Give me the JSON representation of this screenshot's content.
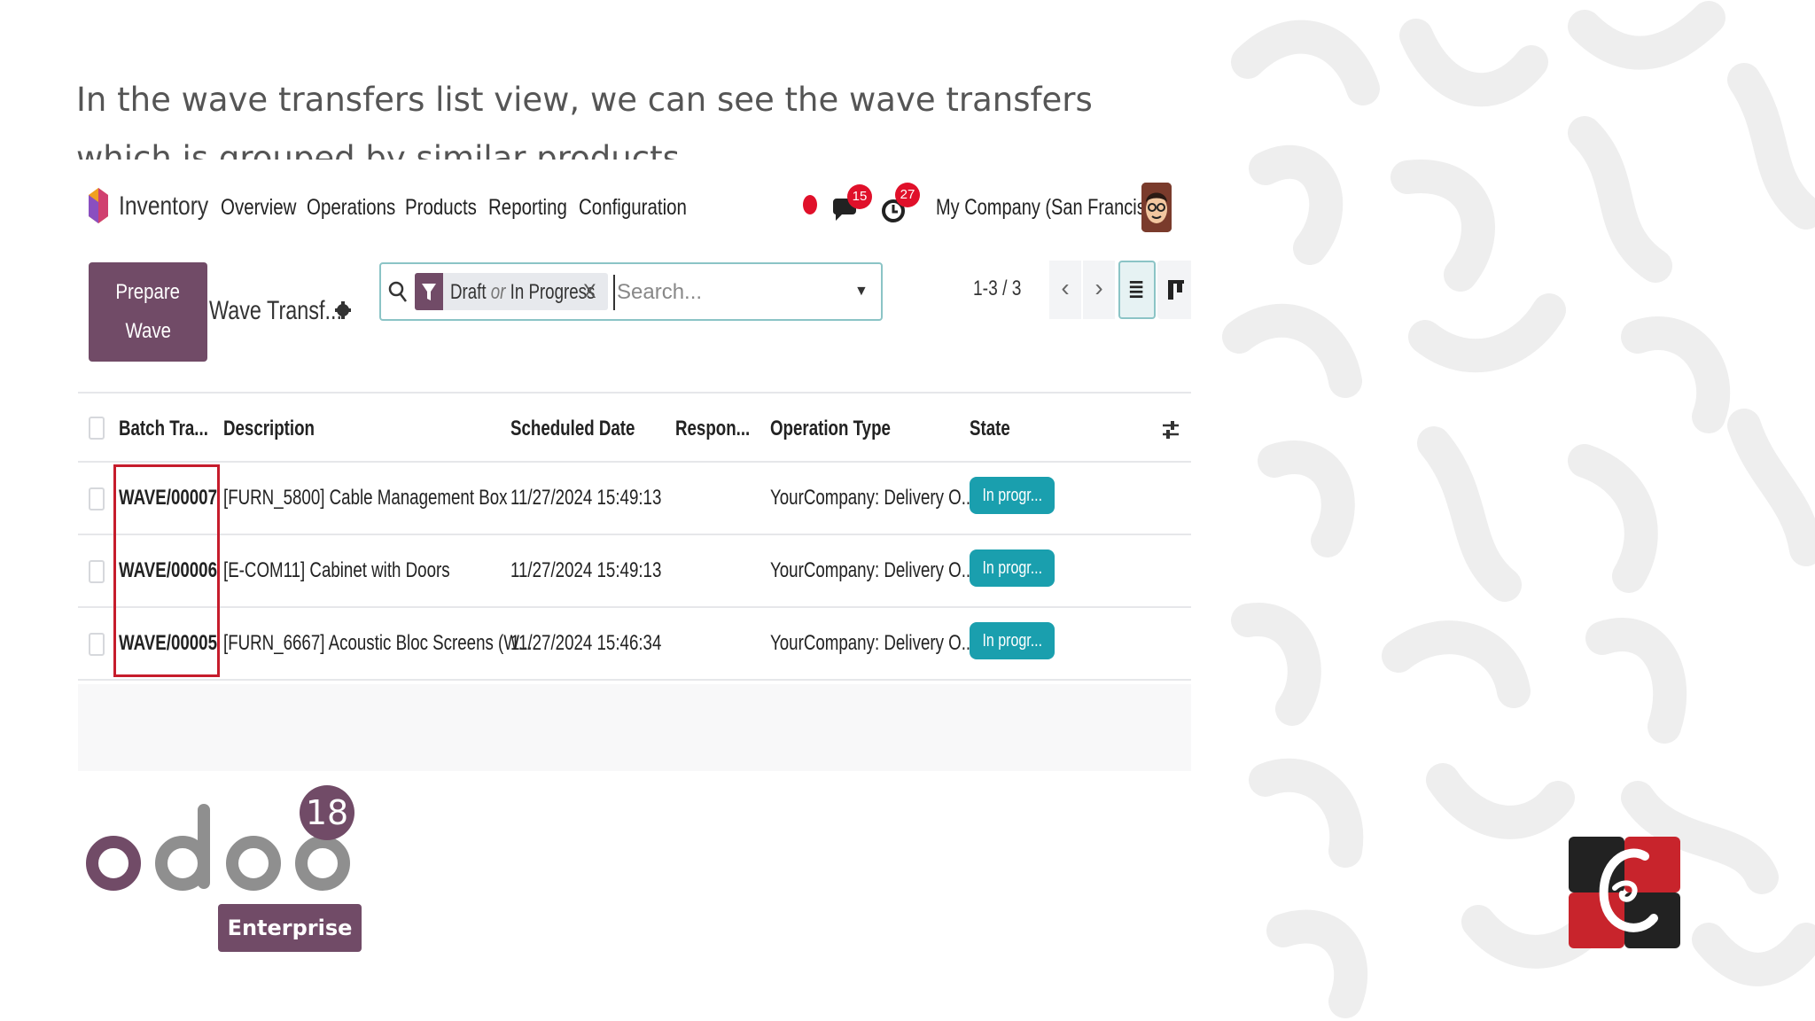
{
  "caption": "In the wave transfers list view, we can see the wave transfers which is grouped by similar products",
  "navbar": {
    "app_name": "Inventory",
    "menu": [
      "Overview",
      "Operations",
      "Products",
      "Reporting",
      "Configuration"
    ],
    "messages_count": "15",
    "activities_count": "27",
    "company": "My Company (San Francisco)"
  },
  "control_panel": {
    "prepare_line1": "Prepare",
    "prepare_line2": "Wave",
    "view_title": "Wave Transf...",
    "facet_part1": "Draft",
    "facet_or": "or",
    "facet_part2": "In Progress",
    "facet_close": "X",
    "search_placeholder": "Search...",
    "pager": "1-3 / 3"
  },
  "table": {
    "headers": [
      "Batch Tra...",
      "Description",
      "Scheduled Date",
      "Respon...",
      "Operation Type",
      "State"
    ],
    "rows": [
      {
        "batch": "WAVE/00007",
        "description": "[FURN_5800] Cable Management Box",
        "date": "11/27/2024 15:49:13",
        "responsible": "",
        "operation": "YourCompany: Delivery O...",
        "state": "In progr..."
      },
      {
        "batch": "WAVE/00006",
        "description": "[E-COM11] Cabinet with Doors",
        "date": "11/27/2024 15:49:13",
        "responsible": "",
        "operation": "YourCompany: Delivery O...",
        "state": "In progr..."
      },
      {
        "batch": "WAVE/00005",
        "description": "[FURN_6667] Acoustic Bloc Screens (W...",
        "date": "11/27/2024 15:46:34",
        "responsible": "",
        "operation": "YourCompany: Delivery O...",
        "state": "In progr..."
      }
    ]
  },
  "branding": {
    "product_logo": "odoo",
    "version": "18",
    "edition": "Enterprise"
  },
  "colors": {
    "brand_purple": "#714b67",
    "state_teal": "#1a9fae",
    "badge_red": "#e0102a",
    "highlight_red": "#c61c2c"
  }
}
